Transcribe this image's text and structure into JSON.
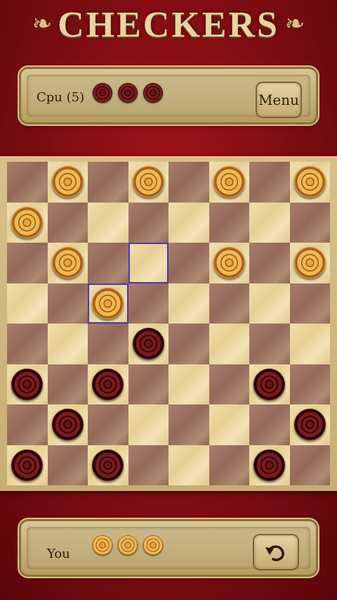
{
  "app": {
    "title": "CHECKERS",
    "accent_color": "#a5161c",
    "panel_color": "#c9b480"
  },
  "cpu": {
    "label": "Cpu (5)",
    "captured_count": 3,
    "captured_piece_color": "red"
  },
  "player": {
    "label": "You",
    "captured_count": 3,
    "captured_piece_color": "gold"
  },
  "buttons": {
    "menu_label": "Menu",
    "undo_icon": "undo-arrow-icon"
  },
  "board": {
    "size": 8,
    "selected": [
      3,
      2
    ],
    "target": [
      2,
      3
    ],
    "pieces": [
      {
        "row": 0,
        "col": 1,
        "color": "gold"
      },
      {
        "row": 0,
        "col": 3,
        "color": "gold"
      },
      {
        "row": 0,
        "col": 5,
        "color": "gold"
      },
      {
        "row": 0,
        "col": 7,
        "color": "gold"
      },
      {
        "row": 1,
        "col": 0,
        "color": "gold"
      },
      {
        "row": 2,
        "col": 1,
        "color": "gold"
      },
      {
        "row": 2,
        "col": 5,
        "color": "gold"
      },
      {
        "row": 2,
        "col": 7,
        "color": "gold"
      },
      {
        "row": 3,
        "col": 2,
        "color": "gold"
      },
      {
        "row": 4,
        "col": 3,
        "color": "red"
      },
      {
        "row": 5,
        "col": 0,
        "color": "red"
      },
      {
        "row": 5,
        "col": 2,
        "color": "red"
      },
      {
        "row": 5,
        "col": 6,
        "color": "red"
      },
      {
        "row": 6,
        "col": 1,
        "color": "red"
      },
      {
        "row": 6,
        "col": 7,
        "color": "red"
      },
      {
        "row": 7,
        "col": 0,
        "color": "red"
      },
      {
        "row": 7,
        "col": 2,
        "color": "red"
      },
      {
        "row": 7,
        "col": 6,
        "color": "red"
      }
    ]
  }
}
